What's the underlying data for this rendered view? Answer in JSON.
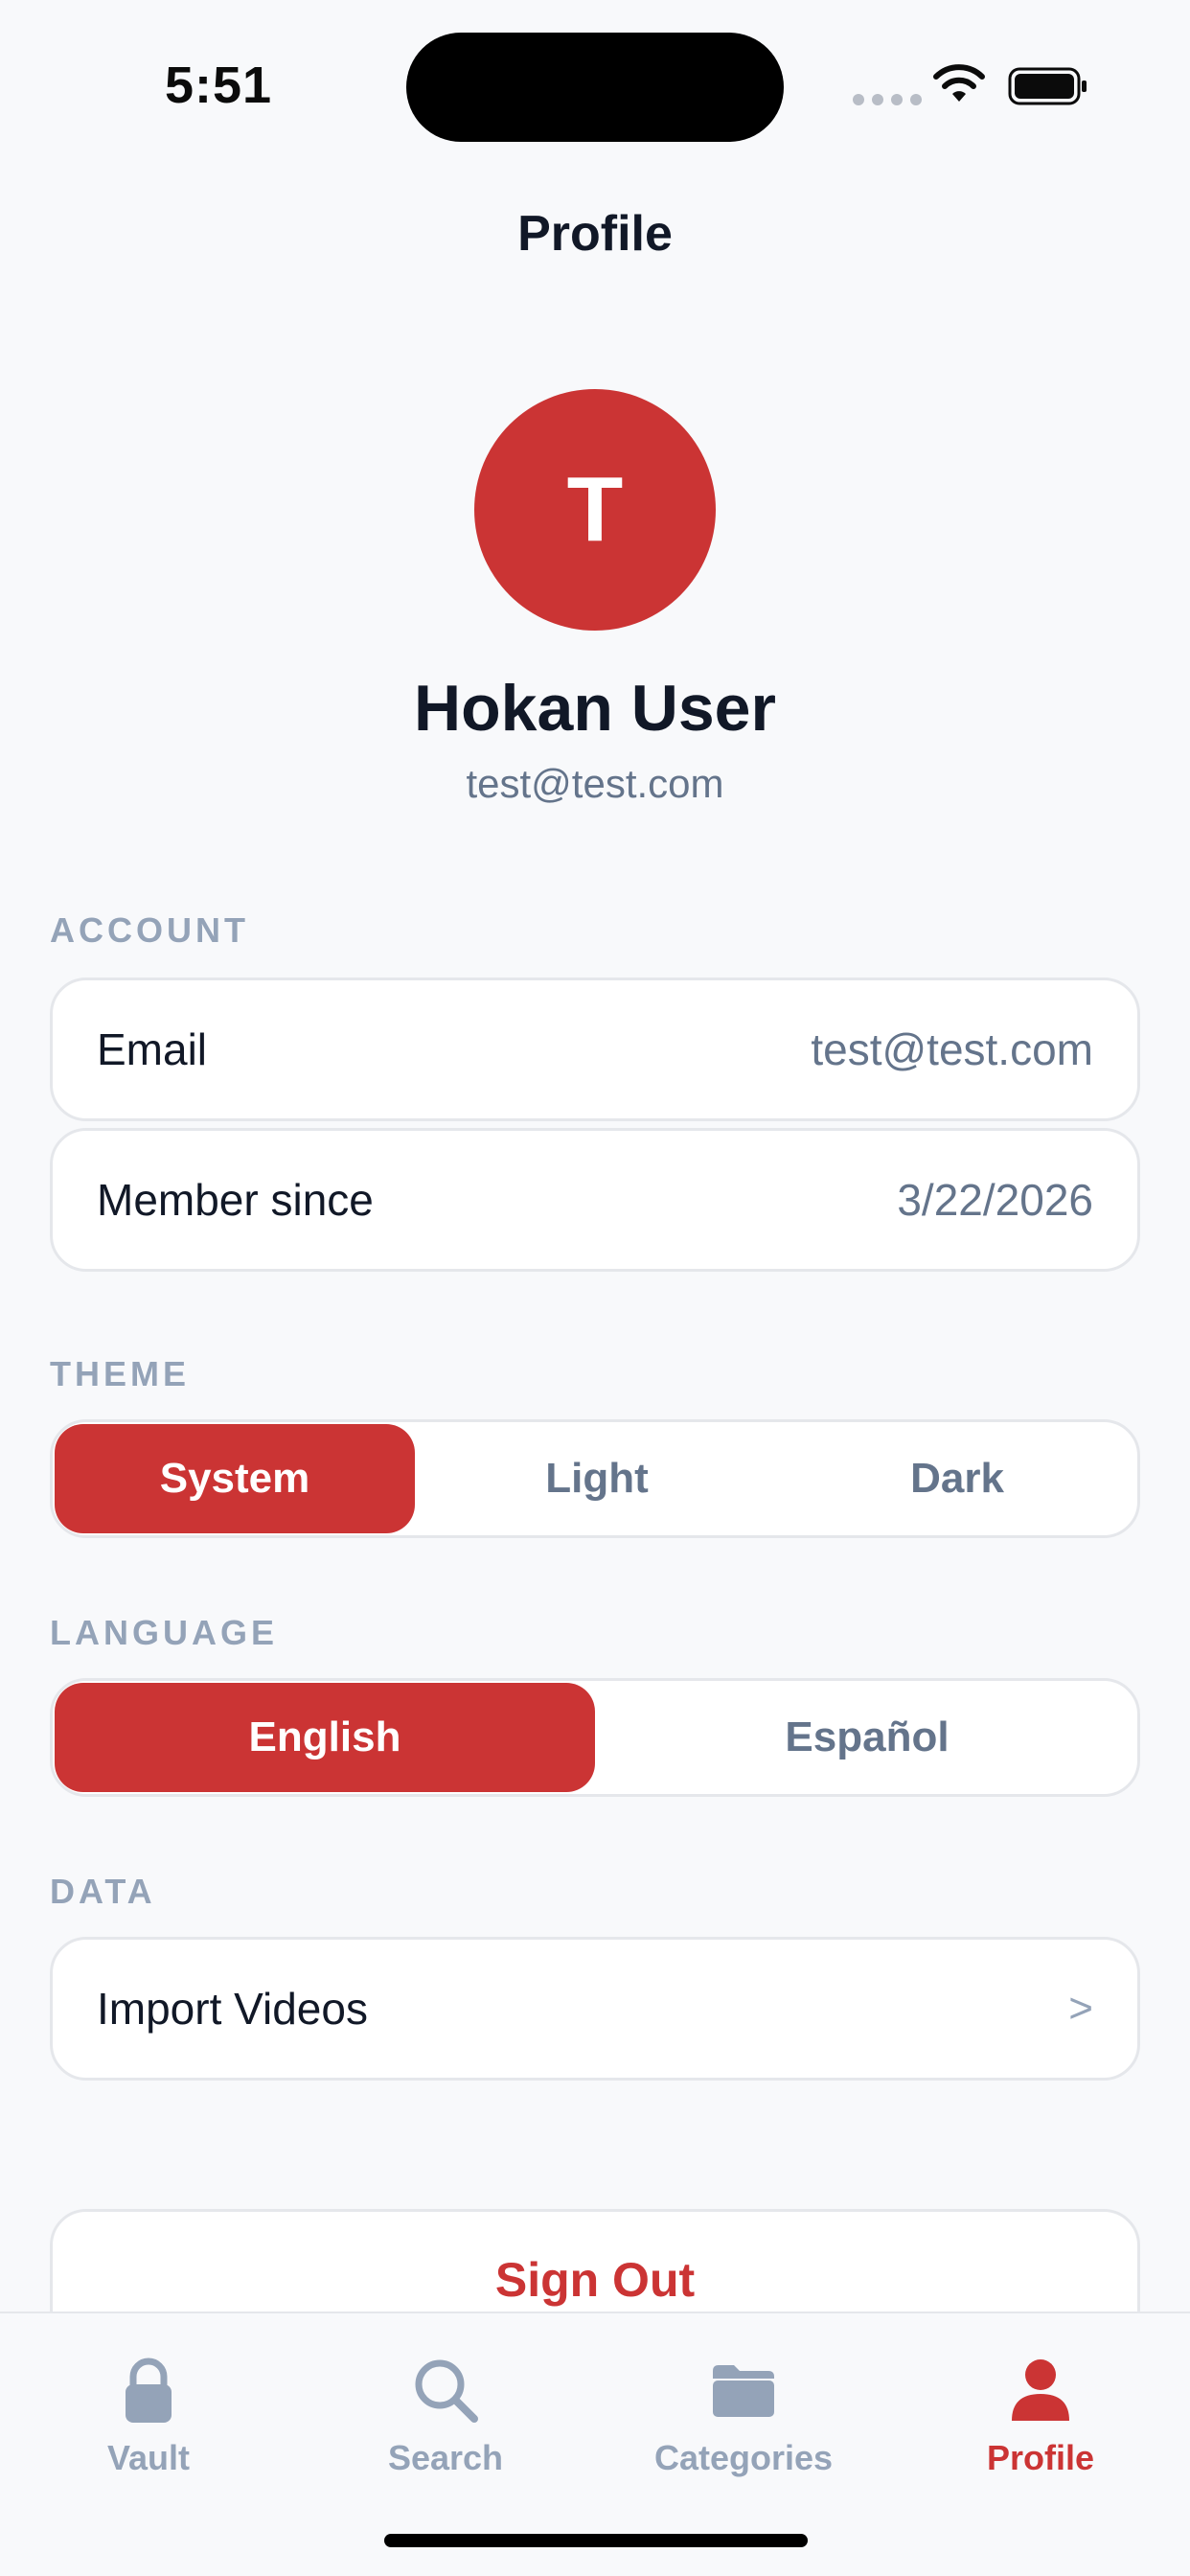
{
  "status_bar": {
    "time": "5:51"
  },
  "header": {
    "title": "Profile"
  },
  "profile": {
    "initial": "T",
    "name": "Hokan User",
    "email": "test@test.com"
  },
  "account": {
    "label": "ACCOUNT",
    "rows": [
      {
        "label": "Email",
        "value": "test@test.com"
      },
      {
        "label": "Member since",
        "value": "3/22/2026"
      }
    ]
  },
  "theme": {
    "label": "THEME",
    "options": [
      "System",
      "Light",
      "Dark"
    ],
    "selected": "System"
  },
  "language": {
    "label": "LANGUAGE",
    "options": [
      "English",
      "Español"
    ],
    "selected": "English"
  },
  "data_section": {
    "label": "DATA",
    "import_label": "Import Videos",
    "chevron": ">"
  },
  "sign_out": {
    "label": "Sign Out"
  },
  "tab_bar": {
    "tabs": [
      {
        "label": "Vault",
        "icon": "lock-icon"
      },
      {
        "label": "Search",
        "icon": "search-icon"
      },
      {
        "label": "Categories",
        "icon": "folder-icon"
      },
      {
        "label": "Profile",
        "icon": "person-icon"
      }
    ],
    "active": "Profile"
  },
  "colors": {
    "accent": "#CB3434",
    "muted": "#94A3B8",
    "background": "#F8F9FB"
  }
}
